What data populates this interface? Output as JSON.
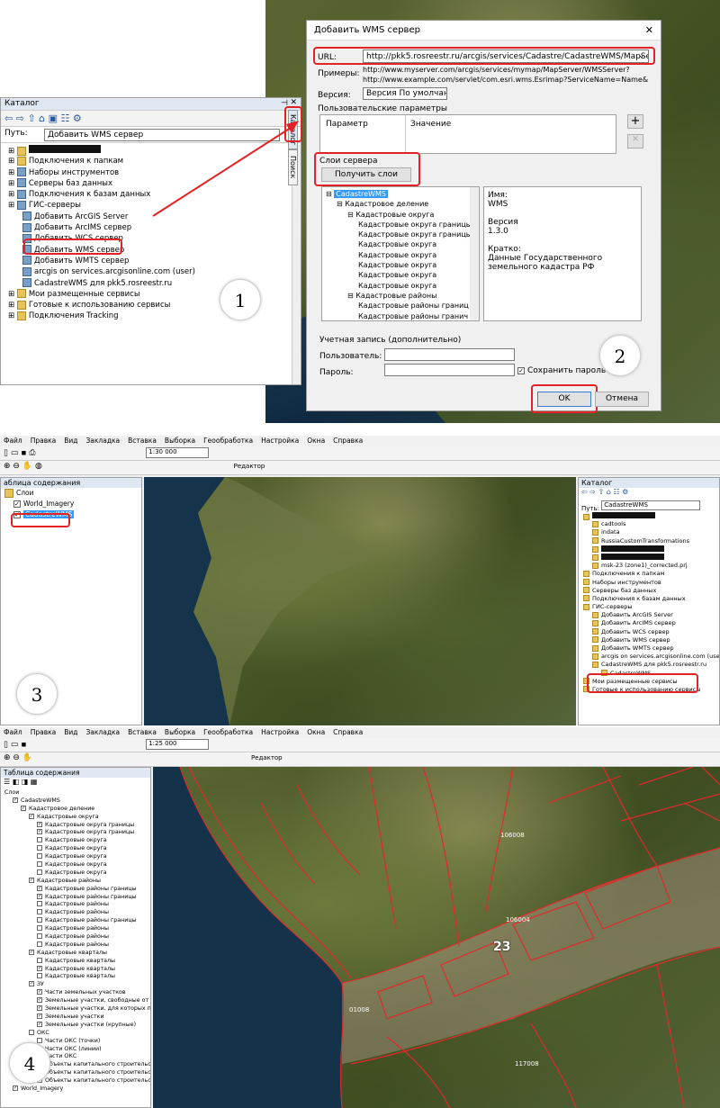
{
  "catalog": {
    "title": "Каталог",
    "path_label": "Путь:",
    "path_value": "Добавить WMS сервер",
    "side_tabs": [
      "Каталог",
      "Поиск"
    ],
    "items": [
      {
        "label": "",
        "icon": "folder-icon",
        "indent": 0
      },
      {
        "label": "Подключения к папкам",
        "icon": "folder-icon",
        "indent": 0
      },
      {
        "label": "Наборы инструментов",
        "icon": "toolbox-icon",
        "indent": 0
      },
      {
        "label": "Серверы баз данных",
        "icon": "database-icon",
        "indent": 0
      },
      {
        "label": "Подключения к базам данных",
        "icon": "database-icon",
        "indent": 0
      },
      {
        "label": "ГИС-серверы",
        "icon": "server-icon",
        "indent": 0
      },
      {
        "label": "Добавить ArcGIS Server",
        "icon": "server-icon",
        "indent": 1
      },
      {
        "label": "Добавить ArcIMS сервер",
        "icon": "server-icon",
        "indent": 1
      },
      {
        "label": "Добавить WCS сервер",
        "icon": "server-icon",
        "indent": 1
      },
      {
        "label": "Добавить WMS сервер",
        "icon": "server-icon",
        "indent": 1
      },
      {
        "label": "Добавить WMTS сервер",
        "icon": "server-icon",
        "indent": 1
      },
      {
        "label": "arcgis on services.arcgisonline.com (user)",
        "icon": "globe-icon",
        "indent": 1
      },
      {
        "label": "CadastreWMS для pkk5.rosreestr.ru",
        "icon": "globe-icon",
        "indent": 1
      },
      {
        "label": "Мои размещенные сервисы",
        "icon": "folder-icon",
        "indent": 0
      },
      {
        "label": "Готовые к использованию сервисы",
        "icon": "folder-icon",
        "indent": 0
      },
      {
        "label": "Подключения Tracking",
        "icon": "folder-icon",
        "indent": 0
      }
    ]
  },
  "dialog": {
    "title": "Добавить WMS сервер",
    "url_label": "URL:",
    "url_value": "http://pkk5.rosreestr.ru/arcgis/services/Cadastre/CadastreWMS/MapServer/WMSServer",
    "examples_label": "Примеры:",
    "example1": "http://www.myserver.com/arcgis/services/mymap/MapServer/WMSServer?",
    "example2": "http://www.example.com/servlet/com.esri.wms.Esrimap?ServiceName=Name&",
    "version_label": "Версия:",
    "version_value": "Версия По умолчанию",
    "user_params_label": "Пользовательские параметры",
    "param_col": "Параметр",
    "value_col": "Значение",
    "server_layers_label": "Слои сервера",
    "get_layers_button": "Получить слои",
    "layers_tree": [
      {
        "label": "CadastreWMS",
        "indent": 0
      },
      {
        "label": "Кадастровое деление",
        "indent": 1
      },
      {
        "label": "Кадастровые округа",
        "indent": 2
      },
      {
        "label": "Кадастровые округа границы",
        "indent": 3
      },
      {
        "label": "Кадастровые округа границы",
        "indent": 3
      },
      {
        "label": "Кадастровые округа",
        "indent": 3
      },
      {
        "label": "Кадастровые округа",
        "indent": 3
      },
      {
        "label": "Кадастровые округа",
        "indent": 3
      },
      {
        "label": "Кадастровые округа",
        "indent": 3
      },
      {
        "label": "Кадастровые округа",
        "indent": 3
      },
      {
        "label": "Кадастровые районы",
        "indent": 2
      },
      {
        "label": "Кадастровые районы границ",
        "indent": 3
      },
      {
        "label": "Кадастровые районы гранич",
        "indent": 3
      }
    ],
    "info_name_label": "Имя:",
    "info_name": "WMS",
    "info_version_label": "Версия",
    "info_version": "1.3.0",
    "info_brief_label": "Кратко:",
    "info_brief": "Данные Государственного земельного кадастра РФ",
    "account_label": "Учетная запись (дополнительно)",
    "user_label": "Пользователь:",
    "password_label": "Пароль:",
    "save_password": "Сохранить пароль",
    "ok": "OK",
    "cancel": "Отмена"
  },
  "arcmap": {
    "menu": [
      "Файл",
      "Правка",
      "Вид",
      "Закладка",
      "Вставка",
      "Выборка",
      "Геообработка",
      "Настройка",
      "Окна",
      "Справка"
    ],
    "scale1": "1:30 000",
    "scale2": "1:25 000",
    "editor": "Редактор",
    "toc_title": "аблица содержания",
    "toc_title2": "Таблица содержания",
    "layers_root": "Слои",
    "world_imagery": "World_Imagery",
    "cadastre": "CadastreWMS",
    "catalog_title": "Каталог",
    "catalog_path_label": "Путь:",
    "catalog_path": "CadastreWMS",
    "catalog_items": [
      {
        "label": "",
        "indent": 0
      },
      {
        "label": "cadtools",
        "indent": 1
      },
      {
        "label": "indata",
        "indent": 1
      },
      {
        "label": "RussiaCustomTransformations",
        "indent": 1
      },
      {
        "label": "",
        "indent": 1
      },
      {
        "label": "",
        "indent": 1
      },
      {
        "label": "msk-23 (zone1)_corrected.prj",
        "indent": 1
      },
      {
        "label": "Подключения к папкам",
        "indent": 0
      },
      {
        "label": "Наборы инструментов",
        "indent": 0
      },
      {
        "label": "Серверы баз данных",
        "indent": 0
      },
      {
        "label": "Подключения к базам данных",
        "indent": 0
      },
      {
        "label": "ГИС-серверы",
        "indent": 0
      },
      {
        "label": "Добавить ArcGIS Server",
        "indent": 1
      },
      {
        "label": "Добавить ArcIMS сервер",
        "indent": 1
      },
      {
        "label": "Добавить WCS сервер",
        "indent": 1
      },
      {
        "label": "Добавить WMS сервер",
        "indent": 1
      },
      {
        "label": "Добавить WMTS сервер",
        "indent": 1
      },
      {
        "label": "arcgis on services.arcgisonline.com (user)",
        "indent": 1
      },
      {
        "label": "CadastreWMS для pkk5.rosreestr.ru",
        "indent": 1
      },
      {
        "label": "CadastreWMS",
        "indent": 2
      },
      {
        "label": "Мои размещенные сервисы",
        "indent": 0
      },
      {
        "label": "Готовые к использованию сервисы",
        "indent": 0
      }
    ]
  },
  "toc4": [
    {
      "label": "Слои",
      "indent": 0,
      "chk": ""
    },
    {
      "label": "CadastreWMS",
      "indent": 1,
      "chk": "✓"
    },
    {
      "label": "Кадастровое деление",
      "indent": 2,
      "chk": "✓"
    },
    {
      "label": "Кадастровые округа",
      "indent": 3,
      "chk": "✓"
    },
    {
      "label": "Кадастровые округа границы",
      "indent": 4,
      "chk": "✓"
    },
    {
      "label": "Кадастровые округа границы",
      "indent": 4,
      "chk": "✓"
    },
    {
      "label": "Кадастровые округа",
      "indent": 4,
      "chk": ""
    },
    {
      "label": "Кадастровые округа",
      "indent": 4,
      "chk": ""
    },
    {
      "label": "Кадастровые округа",
      "indent": 4,
      "chk": ""
    },
    {
      "label": "Кадастровые округа",
      "indent": 4,
      "chk": ""
    },
    {
      "label": "Кадастровые округа",
      "indent": 4,
      "chk": ""
    },
    {
      "label": "Кадастровые районы",
      "indent": 3,
      "chk": "✓"
    },
    {
      "label": "Кадастровые районы границы",
      "indent": 4,
      "chk": "✓"
    },
    {
      "label": "Кадастровые районы границы",
      "indent": 4,
      "chk": "✓"
    },
    {
      "label": "Кадастровые районы",
      "indent": 4,
      "chk": ""
    },
    {
      "label": "Кадастровые районы",
      "indent": 4,
      "chk": ""
    },
    {
      "label": "Кадастровые районы границы",
      "indent": 4,
      "chk": ""
    },
    {
      "label": "Кадастровые районы",
      "indent": 4,
      "chk": ""
    },
    {
      "label": "Кадастровые районы",
      "indent": 4,
      "chk": ""
    },
    {
      "label": "Кадастровые районы",
      "indent": 4,
      "chk": ""
    },
    {
      "label": "Кадастровые кварталы",
      "indent": 3,
      "chk": "✓"
    },
    {
      "label": "Кадастровые кварталы",
      "indent": 4,
      "chk": ""
    },
    {
      "label": "Кадастровые кварталы",
      "indent": 4,
      "chk": "✓"
    },
    {
      "label": "Кадастровые кварталы",
      "indent": 4,
      "chk": ""
    },
    {
      "label": "ЗУ",
      "indent": 3,
      "chk": "✓"
    },
    {
      "label": "Части земельных участков",
      "indent": 4,
      "chk": "✓"
    },
    {
      "label": "Земельные участки, свободные от г",
      "indent": 4,
      "chk": "✓"
    },
    {
      "label": "Земельные участки, для которых пр",
      "indent": 4,
      "chk": "✓"
    },
    {
      "label": "Земельные участки",
      "indent": 4,
      "chk": "✓"
    },
    {
      "label": "Земельные участки (крупные)",
      "indent": 4,
      "chk": "✓"
    },
    {
      "label": "ОКС",
      "indent": 3,
      "chk": ""
    },
    {
      "label": "Части ОКС (точки)",
      "indent": 4,
      "chk": ""
    },
    {
      "label": "Части ОКС (линии)",
      "indent": 4,
      "chk": ""
    },
    {
      "label": "Части ОКС",
      "indent": 4,
      "chk": ""
    },
    {
      "label": "Объекты капитального строительст",
      "indent": 4,
      "chk": ""
    },
    {
      "label": "Объекты капитального строительст",
      "indent": 4,
      "chk": ""
    },
    {
      "label": "Объекты капитального строительст",
      "indent": 4,
      "chk": ""
    },
    {
      "label": "World_Imagery",
      "indent": 1,
      "chk": "✓"
    }
  ],
  "map_labels": {
    "region": "23",
    "q1": "106008",
    "q2": "106004",
    "q3": "117008",
    "q4": "01008"
  },
  "badges": [
    "1",
    "2",
    "3",
    "4"
  ],
  "colors": {
    "highlight": "#e32226",
    "selection": "#3399ff"
  }
}
